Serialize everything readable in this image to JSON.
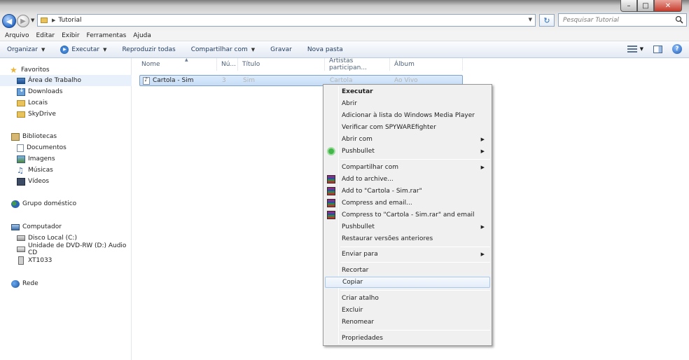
{
  "window": {
    "minimize_label": "–",
    "maximize_label": "□",
    "close_label": "✕"
  },
  "address": {
    "path": "Tutorial",
    "back_label": "◀",
    "forward_label": "▶",
    "refresh_label": "↻"
  },
  "search": {
    "placeholder": "Pesquisar Tutorial"
  },
  "menubar": {
    "items": [
      "Arquivo",
      "Editar",
      "Exibir",
      "Ferramentas",
      "Ajuda"
    ]
  },
  "commandbar": {
    "organize": "Organizar",
    "execute": "Executar",
    "play_all": "Reproduzir todas",
    "share_with": "Compartilhar com",
    "burn": "Gravar",
    "new_folder": "Nova pasta",
    "help_label": "?"
  },
  "navpane": {
    "favorites": "Favoritos",
    "desktop": "Área de Trabalho",
    "downloads": "Downloads",
    "recent": "Locais",
    "skydrive": "SkyDrive",
    "libraries": "Bibliotecas",
    "documents": "Documentos",
    "images": "Imagens",
    "music": "Músicas",
    "videos": "Vídeos",
    "homegroup": "Grupo doméstico",
    "computer": "Computador",
    "local_disk": "Disco Local (C:)",
    "dvd_drive": "Unidade de DVD-RW (D:) Audio CD",
    "device": "XT1033",
    "network": "Rede"
  },
  "columns": {
    "name": "Nome",
    "number": "Nú...",
    "title": "Título",
    "artists": "Artistas participan...",
    "album": "Álbum"
  },
  "file": {
    "name": "Cartola - Sim",
    "number": "3",
    "title": "Sim",
    "artists": "Cartola",
    "album": "Ao Vivo"
  },
  "context_menu": {
    "execute": "Executar",
    "open": "Abrir",
    "add_wmp": "Adicionar à lista do Windows Media Player",
    "verify_spyware": "Verificar com SPYWAREfighter",
    "open_with": "Abrir com",
    "pushbullet_1": "Pushbullet",
    "share_with": "Compartilhar com",
    "add_archive": "Add to archive...",
    "add_to_rar": "Add to \"Cartola - Sim.rar\"",
    "compress_email": "Compress and email...",
    "compress_rar_email": "Compress to \"Cartola - Sim.rar\" and email",
    "pushbullet_2": "Pushbullet",
    "restore_versions": "Restaurar versões anteriores",
    "send_to": "Enviar para",
    "cut": "Recortar",
    "copy": "Copiar",
    "create_shortcut": "Criar atalho",
    "delete": "Excluir",
    "rename": "Renomear",
    "properties": "Propriedades"
  }
}
